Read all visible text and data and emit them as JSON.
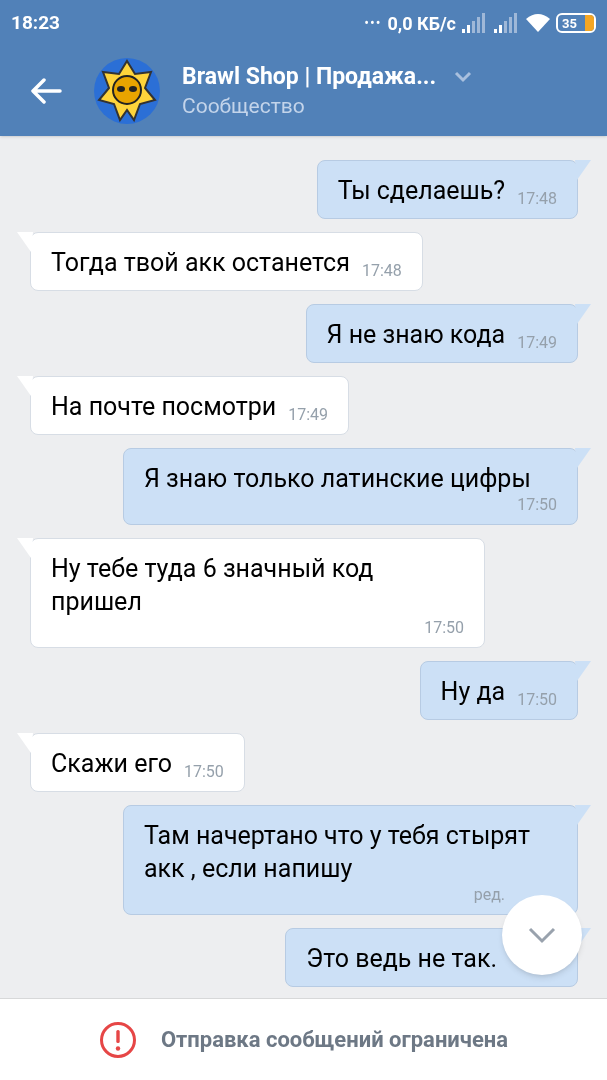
{
  "status_bar": {
    "time": "18:23",
    "dots": "•••",
    "speed": "0,0 КБ/с",
    "battery": "35"
  },
  "header": {
    "title": "Brawl Shop | Продажа...",
    "subtitle": "Сообщество"
  },
  "messages": [
    {
      "kind": "outgoing",
      "text": "Ты сделаешь?",
      "time": "17:48"
    },
    {
      "kind": "incoming",
      "text": "Тогда твой акк останется",
      "time": "17:48"
    },
    {
      "kind": "outgoing",
      "text": "Я не знаю кода",
      "time": "17:49"
    },
    {
      "kind": "incoming",
      "text": "На почте посмотри",
      "time": "17:49"
    },
    {
      "kind": "outgoing",
      "text": "Я знаю только латинские цифры",
      "time": "17:50"
    },
    {
      "kind": "incoming",
      "text": "Ну тебе туда 6 значный код пришел",
      "time": "17:50"
    },
    {
      "kind": "outgoing",
      "text": "Ну да",
      "time": "17:50"
    },
    {
      "kind": "incoming",
      "text": "Скажи его",
      "time": "17:50"
    },
    {
      "kind": "outgoing",
      "text": "Там начертано что у тебя стырят акк , если напишу",
      "time": "ред.",
      "partly_covered": true
    },
    {
      "kind": "outgoing",
      "text": "Это ведь не так.",
      "partly_covered": true
    }
  ],
  "notice": {
    "text": "Отправка сообщений ограничена"
  }
}
